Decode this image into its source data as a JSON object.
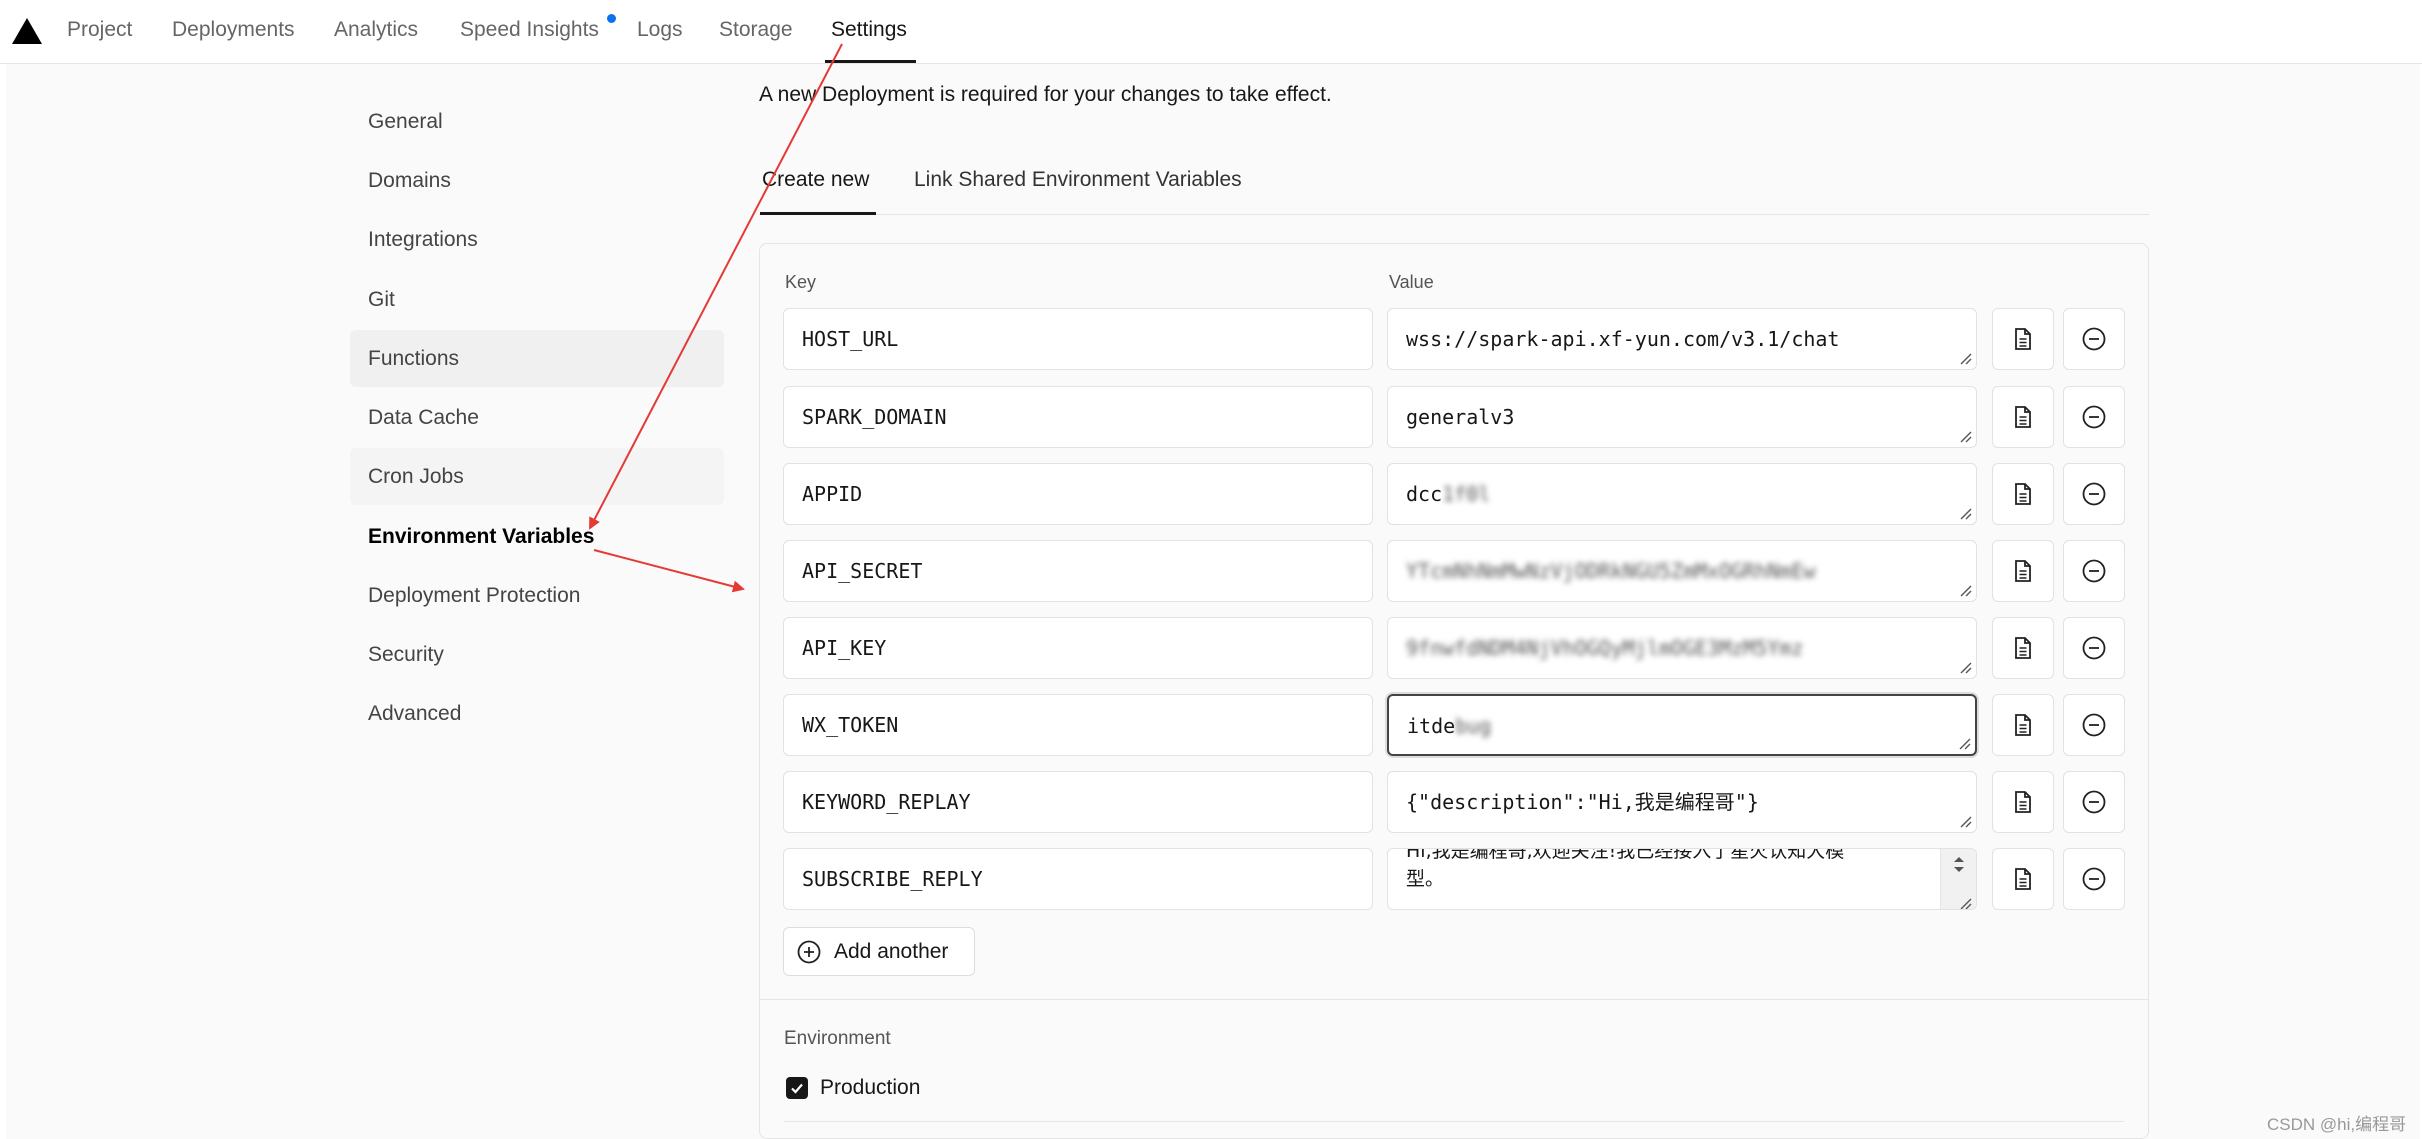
{
  "nav": {
    "tabs": [
      {
        "label": "Project"
      },
      {
        "label": "Deployments"
      },
      {
        "label": "Analytics"
      },
      {
        "label": "Speed Insights"
      },
      {
        "label": "Logs"
      },
      {
        "label": "Storage"
      },
      {
        "label": "Settings"
      }
    ],
    "active_tab": "Settings",
    "accent_color": "#0a72ef"
  },
  "sidebar": {
    "items": [
      {
        "label": "General"
      },
      {
        "label": "Domains"
      },
      {
        "label": "Integrations"
      },
      {
        "label": "Git"
      },
      {
        "label": "Functions"
      },
      {
        "label": "Data Cache"
      },
      {
        "label": "Cron Jobs"
      },
      {
        "label": "Environment Variables"
      },
      {
        "label": "Deployment Protection"
      },
      {
        "label": "Security"
      },
      {
        "label": "Advanced"
      }
    ],
    "active_item": "Environment Variables"
  },
  "main": {
    "notice": "A new Deployment is required for your changes to take effect.",
    "subtabs": [
      {
        "label": "Create new"
      },
      {
        "label": "Link Shared Environment Variables"
      }
    ],
    "key_header": "Key",
    "value_header": "Value",
    "env_vars": [
      {
        "key": "HOST_URL",
        "value": "wss://spark-api.xf-yun.com/v3.1/chat"
      },
      {
        "key": "SPARK_DOMAIN",
        "value": "generalv3"
      },
      {
        "key": "APPID",
        "value": "dcc",
        "value_blurred": "1f0l"
      },
      {
        "key": "API_SECRET",
        "value": "",
        "value_blurred": "YTcmNhNmMwNzVjODRkNGU5ZmMxOGRhNmEw"
      },
      {
        "key": "API_KEY",
        "value": "",
        "value_blurred": "9fnwfdNDM4NjVhOGQyMjlmOGE3MzM5Ymz"
      },
      {
        "key": "WX_TOKEN",
        "value": "itde",
        "value_blurred": "bug"
      },
      {
        "key": "KEYWORD_REPLAY",
        "value": "{\"description\":\"Hi,我是编程哥\"}"
      },
      {
        "key": "SUBSCRIBE_REPLY",
        "value_line1": "Hi,我是编程哥,欢迎关注!我已经接入了星火认知大模",
        "value_line2": "型。"
      }
    ],
    "add_button": "Add another",
    "environment_label": "Environment",
    "production_label": "Production",
    "production_checked": true
  },
  "watermark": "CSDN @hi,编程哥",
  "annotation_color": "#e53935"
}
